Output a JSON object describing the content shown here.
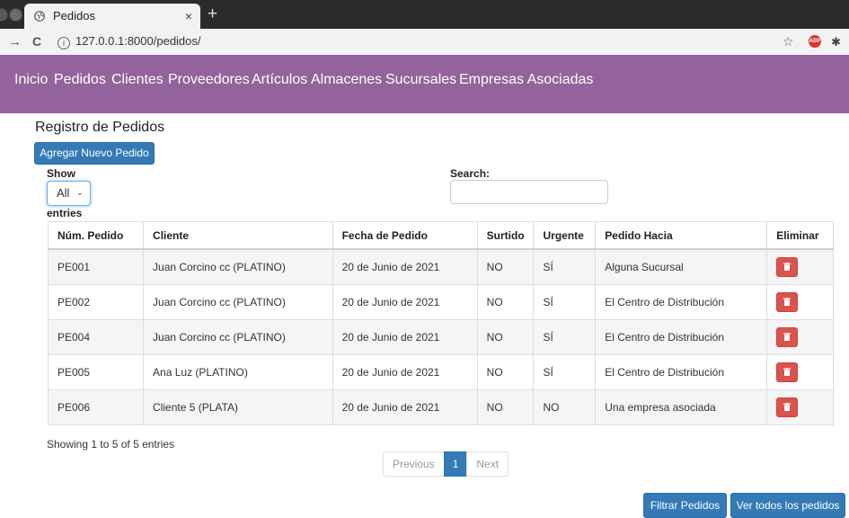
{
  "browser": {
    "tab_title": "Pedidos",
    "tab_close": "×",
    "new_tab": "+",
    "back": "→",
    "reload": "C",
    "info": "i",
    "url": "127.0.0.1:8000/pedidos/",
    "star": "☆",
    "adblock": "ABP",
    "extension": "✱"
  },
  "nav": {
    "items": [
      "Inicio",
      "Pedidos",
      "Clientes",
      "Proveedores",
      "Artículos",
      "Almacenes",
      "Sucursales",
      "Empresas Asociadas"
    ]
  },
  "page": {
    "title": "Registro de Pedidos",
    "add_button": "Agregar Nuevo Pedido"
  },
  "length": {
    "show_label": "Show",
    "value": "All",
    "chevron": "⌄",
    "entries_label": "entries"
  },
  "search": {
    "label": "Search:",
    "value": ""
  },
  "table": {
    "headers": [
      "Núm. Pedido",
      "Cliente",
      "Fecha de Pedido",
      "Surtido",
      "Urgente",
      "Pedido Hacia",
      "Eliminar"
    ],
    "rows": [
      [
        "PE001",
        "Juan Corcino cc (PLATINO)",
        "20 de Junio de 2021",
        "NO",
        "SÍ",
        "Alguna Sucursal"
      ],
      [
        "PE002",
        "Juan Corcino cc (PLATINO)",
        "20 de Junio de 2021",
        "NO",
        "SÍ",
        "El Centro de Distribución"
      ],
      [
        "PE004",
        "Juan Corcino cc (PLATINO)",
        "20 de Junio de 2021",
        "NO",
        "SÍ",
        "El Centro de Distribución"
      ],
      [
        "PE005",
        "Ana Luz (PLATINO)",
        "20 de Junio de 2021",
        "NO",
        "SÍ",
        "El Centro de Distribución"
      ],
      [
        "PE006",
        "Cliente 5 (PLATA)",
        "20 de Junio de 2021",
        "NO",
        "NO",
        "Una empresa asociada"
      ]
    ]
  },
  "info": "Showing 1 to 5 of 5 entries",
  "pagination": {
    "previous": "Previous",
    "current": "1",
    "next": "Next"
  },
  "actions": {
    "filter": "Filtrar Pedidos",
    "view_all": "Ver todos los pedidos"
  },
  "colors": {
    "navbar": "#94629c",
    "primary": "#337ab7",
    "danger": "#d9534f"
  }
}
